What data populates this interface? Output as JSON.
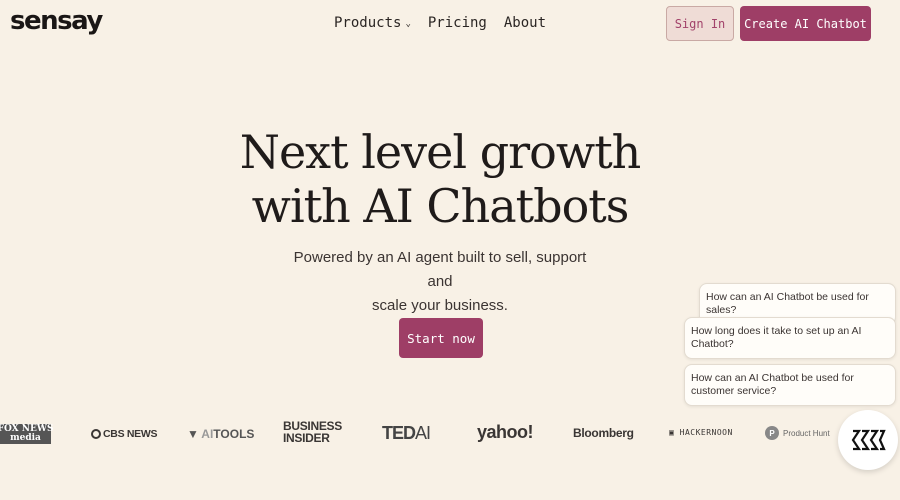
{
  "header": {
    "logo_text": "sensay",
    "nav": [
      {
        "label": "Products",
        "has_dropdown": true
      },
      {
        "label": "Pricing"
      },
      {
        "label": "About"
      }
    ],
    "sign_in_label": "Sign In",
    "create_label": "Create AI Chatbot"
  },
  "hero": {
    "title_line1": "Next level growth",
    "title_line2": "with AI Chatbots",
    "subtitle_line1": "Powered by an AI agent built to sell, support and",
    "subtitle_line2": "scale your business.",
    "cta_label": "Start now"
  },
  "suggestions": [
    "How can an AI Chatbot be used for sales?",
    "How long does it take to set up an AI Chatbot?",
    "How can an AI Chatbot be used for customer service?"
  ],
  "press_logos": {
    "fox_line1": "FOX NEWS",
    "fox_line2": "media",
    "cbs": "CBS NEWS",
    "aitools_prefix": "AI",
    "aitools_suffix": "TOOLS",
    "bi_line1": "BUSINESS",
    "bi_line2": "INSIDER",
    "ted_prefix": "TED",
    "ted_suffix": "AI",
    "yahoo": "yahoo!",
    "bloomberg": "Bloomberg",
    "hackernoon": "HACKERNOON",
    "producthunt_letter": "P",
    "producthunt": "Product Hunt"
  },
  "colors": {
    "background": "#f8f1e6",
    "accent": "#9e3e66",
    "sign_in_bg": "#efdcd6"
  }
}
